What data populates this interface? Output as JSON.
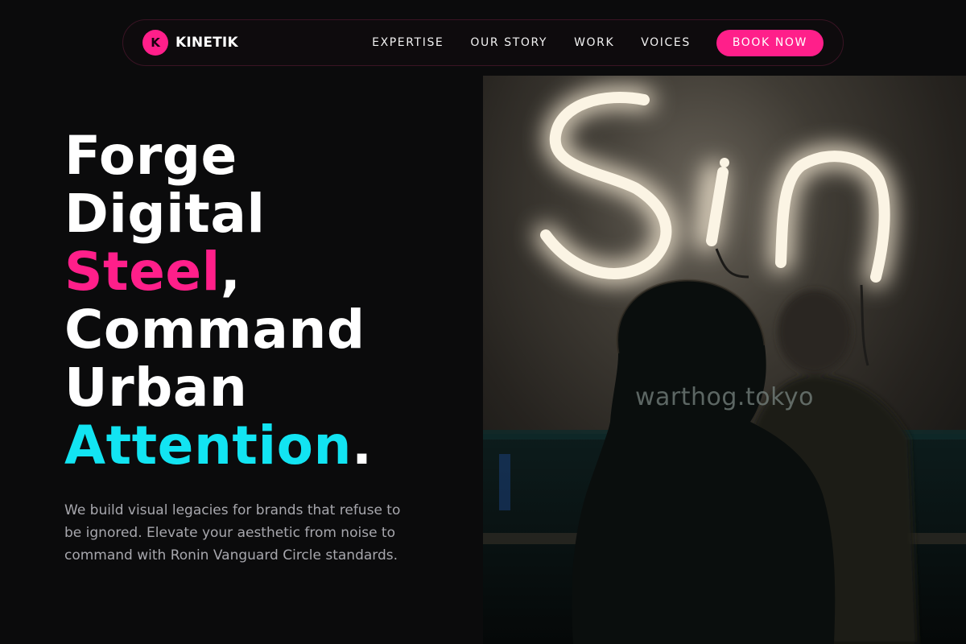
{
  "nav": {
    "brand_initial": "K",
    "brand_name": "KINETIK",
    "links": [
      "EXPERTISE",
      "OUR STORY",
      "WORK",
      "VOICES"
    ],
    "cta": "BOOK NOW"
  },
  "hero": {
    "headline": {
      "line1": "Forge",
      "line2": "Digital",
      "line3_accent": "Steel",
      "line3_rest": ",",
      "line4": "Command",
      "line5": "Urban",
      "line6_accent": "Attention",
      "line6_rest": "."
    },
    "subcopy": "We build visual legacies for brands that refuse to be ignored. Elevate your aesthetic from noise to command with Ronin Vanguard Circle standards."
  },
  "photo": {
    "neon_sign_text": "Sin",
    "watermark": "warthog.tokyo"
  },
  "colors": {
    "accent_pink": "#ff1f8a",
    "accent_cyan": "#12e4f2",
    "background": "#0b0b0c"
  }
}
